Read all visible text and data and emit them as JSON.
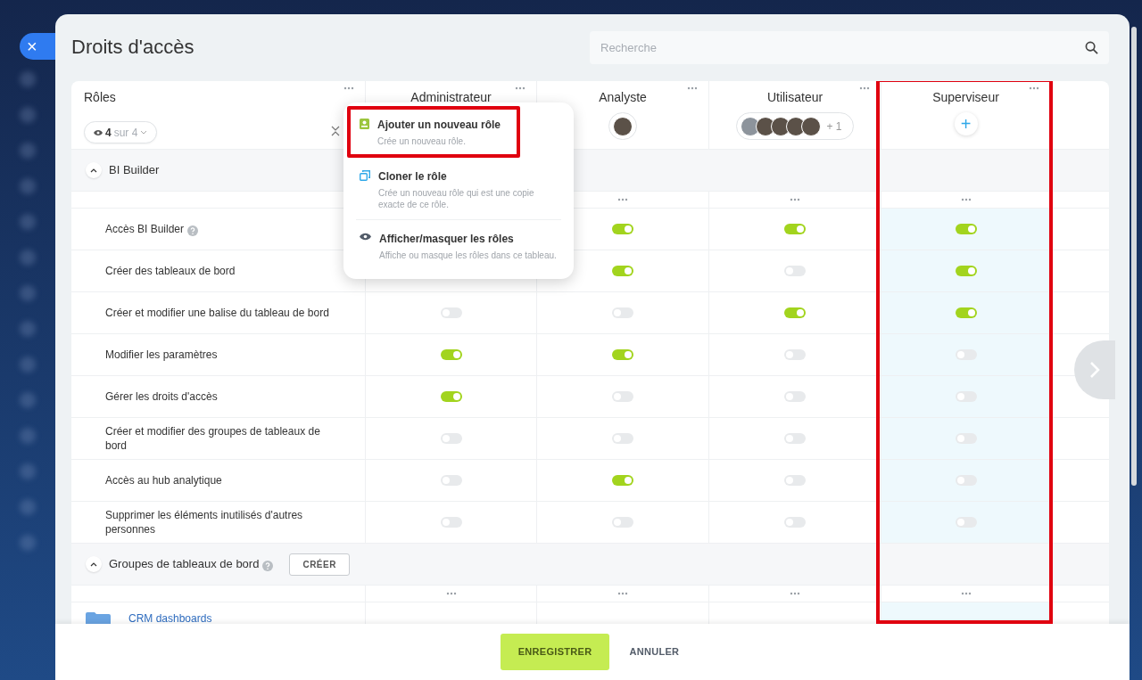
{
  "close": "×",
  "title": "Droits d'accès",
  "search": {
    "placeholder": "Recherche"
  },
  "roles_header": {
    "label": "Rôles",
    "filter": {
      "count": "4",
      "of": "sur 4"
    }
  },
  "roles": [
    {
      "name": "Administrateur",
      "kind": "hidden",
      "highlighted": false
    },
    {
      "name": "Analyste",
      "kind": "avatars",
      "highlighted": false,
      "avatars": [
        {
          "kind": "photo"
        }
      ]
    },
    {
      "name": "Utilisateur",
      "kind": "avatars",
      "highlighted": false,
      "avatars": [
        {
          "kind": "silhouette"
        },
        {
          "kind": "photo"
        },
        {
          "kind": "photo"
        },
        {
          "kind": "photo"
        },
        {
          "kind": "photo"
        }
      ],
      "more": "+ 1"
    },
    {
      "name": "Superviseur",
      "kind": "add",
      "highlighted": true,
      "add": "+"
    }
  ],
  "sections": [
    {
      "title": "BI Builder",
      "expanded": true,
      "help": false,
      "rows": [
        {
          "label": "Accès BI Builder",
          "help": true,
          "cells": [
            {
              "kind": "hidden"
            },
            {
              "kind": "toggle",
              "on": true
            },
            {
              "kind": "toggle",
              "on": true
            },
            {
              "kind": "toggle",
              "on": true
            }
          ]
        },
        {
          "label": "Créer des tableaux de bord",
          "help": false,
          "cells": [
            {
              "kind": "hidden"
            },
            {
              "kind": "toggle",
              "on": true
            },
            {
              "kind": "toggle",
              "on": false
            },
            {
              "kind": "toggle",
              "on": true
            }
          ]
        },
        {
          "label": "Créer et modifier une balise du tableau de bord",
          "help": false,
          "cells": [
            {
              "kind": "toggle",
              "on": false
            },
            {
              "kind": "toggle",
              "on": false
            },
            {
              "kind": "toggle",
              "on": true
            },
            {
              "kind": "toggle",
              "on": true
            }
          ]
        },
        {
          "label": "Modifier les paramètres",
          "help": false,
          "cells": [
            {
              "kind": "toggle",
              "on": true
            },
            {
              "kind": "toggle",
              "on": true
            },
            {
              "kind": "toggle",
              "on": false
            },
            {
              "kind": "toggle",
              "on": false
            }
          ]
        },
        {
          "label": "Gérer les droits d'accès",
          "help": false,
          "cells": [
            {
              "kind": "toggle",
              "on": true
            },
            {
              "kind": "toggle",
              "on": false
            },
            {
              "kind": "toggle",
              "on": false
            },
            {
              "kind": "toggle",
              "on": false
            }
          ]
        },
        {
          "label": "Créer et modifier des groupes de tableaux de bord",
          "help": false,
          "cells": [
            {
              "kind": "toggle",
              "on": false
            },
            {
              "kind": "toggle",
              "on": false
            },
            {
              "kind": "toggle",
              "on": false
            },
            {
              "kind": "toggle",
              "on": false
            }
          ]
        },
        {
          "label": "Accès au hub analytique",
          "help": false,
          "cells": [
            {
              "kind": "toggle",
              "on": false
            },
            {
              "kind": "toggle",
              "on": true
            },
            {
              "kind": "toggle",
              "on": false
            },
            {
              "kind": "toggle",
              "on": false
            }
          ]
        },
        {
          "label": "Supprimer les éléments inutilisés d'autres personnes",
          "help": false,
          "cells": [
            {
              "kind": "toggle",
              "on": false
            },
            {
              "kind": "toggle",
              "on": false
            },
            {
              "kind": "toggle",
              "on": false
            },
            {
              "kind": "toggle",
              "on": false
            }
          ]
        }
      ]
    },
    {
      "title": "Groupes de tableaux de bord",
      "expanded": true,
      "help": true,
      "button": "CRÉER",
      "folders": [
        {
          "label": "CRM dashboards"
        }
      ]
    }
  ],
  "menu": {
    "items": [
      {
        "kind": "add",
        "title": "Ajouter un nouveau rôle",
        "description": "Crée un nouveau rôle.",
        "highlighted": true
      },
      {
        "kind": "clone",
        "title": "Cloner le rôle",
        "description": "Crée un nouveau rôle qui est une copie exacte de ce rôle.",
        "highlighted": false
      },
      {
        "kind": "visibility",
        "title": "Afficher/masquer les rôles",
        "description": "Affiche ou masque les rôles dans ce tableau.",
        "highlighted": false
      }
    ]
  },
  "footer": {
    "save": "ENREGISTRER",
    "cancel": "ANNULER"
  }
}
